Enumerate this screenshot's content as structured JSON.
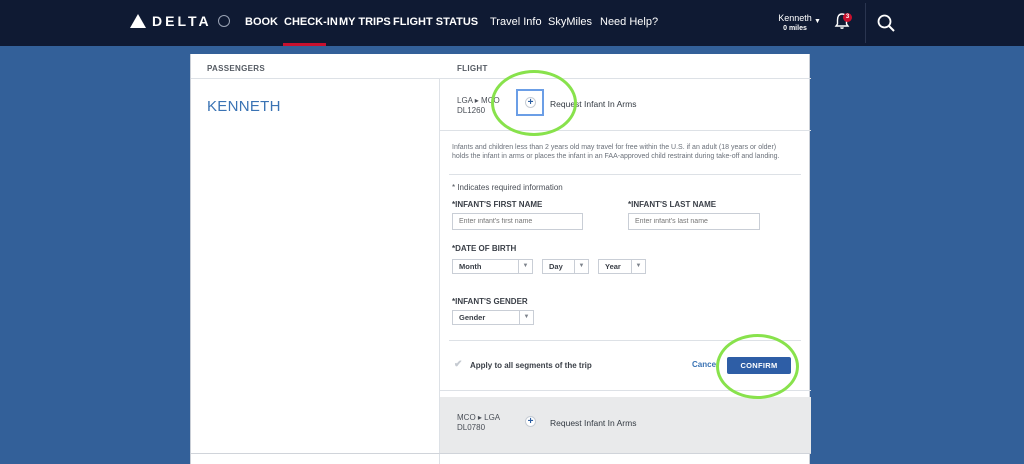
{
  "header": {
    "logo_text": "DELTA",
    "nav": [
      {
        "label": "BOOK"
      },
      {
        "label": "CHECK-IN"
      },
      {
        "label": "MY TRIPS"
      },
      {
        "label": "FLIGHT STATUS"
      },
      {
        "label": "Travel Info"
      },
      {
        "label": "SkyMiles"
      },
      {
        "label": "Need Help?"
      }
    ],
    "active_nav": "CHECK-IN",
    "user": {
      "name": "Kenneth",
      "miles": "0 miles"
    },
    "notification_count": "3",
    "colors": {
      "bar": "#0f1a33",
      "active_underline": "#c8102e"
    }
  },
  "table": {
    "passengers_header": "PASSENGERS",
    "flight_header": "FLIGHT",
    "passenger_name": "KENNETH"
  },
  "segments": [
    {
      "route": "LGA ▸ MCO",
      "flight": "DL1260",
      "action": "Request Infant In Arms"
    },
    {
      "route": "MCO ▸ LGA",
      "flight": "DL0780",
      "action": "Request Infant In Arms"
    }
  ],
  "infant_form": {
    "notice": "Infants and children less than 2 years old may travel for free within the U.S. if an adult (18 years or older) holds the infant in arms or places the infant in an FAA-approved child restraint during take-off and landing.",
    "required_note": "* Indicates required information",
    "first_name_label": "*INFANT'S FIRST NAME",
    "first_name_placeholder": "Enter infant's first name",
    "last_name_label": "*INFANT'S LAST NAME",
    "last_name_placeholder": "Enter infant's last name",
    "dob_label": "*DATE OF BIRTH",
    "month": "Month",
    "day": "Day",
    "year": "Year",
    "gender_label": "*INFANT'S GENDER",
    "gender": "Gender",
    "apply_all": "Apply to all segments of the trip",
    "cancel": "Cance",
    "confirm": "CONFIRM"
  },
  "colors": {
    "page_bg": "#336099",
    "link_blue": "#3a73b4",
    "confirm_bg": "#2e5ea6",
    "highlight_ring": "#88e24c"
  }
}
